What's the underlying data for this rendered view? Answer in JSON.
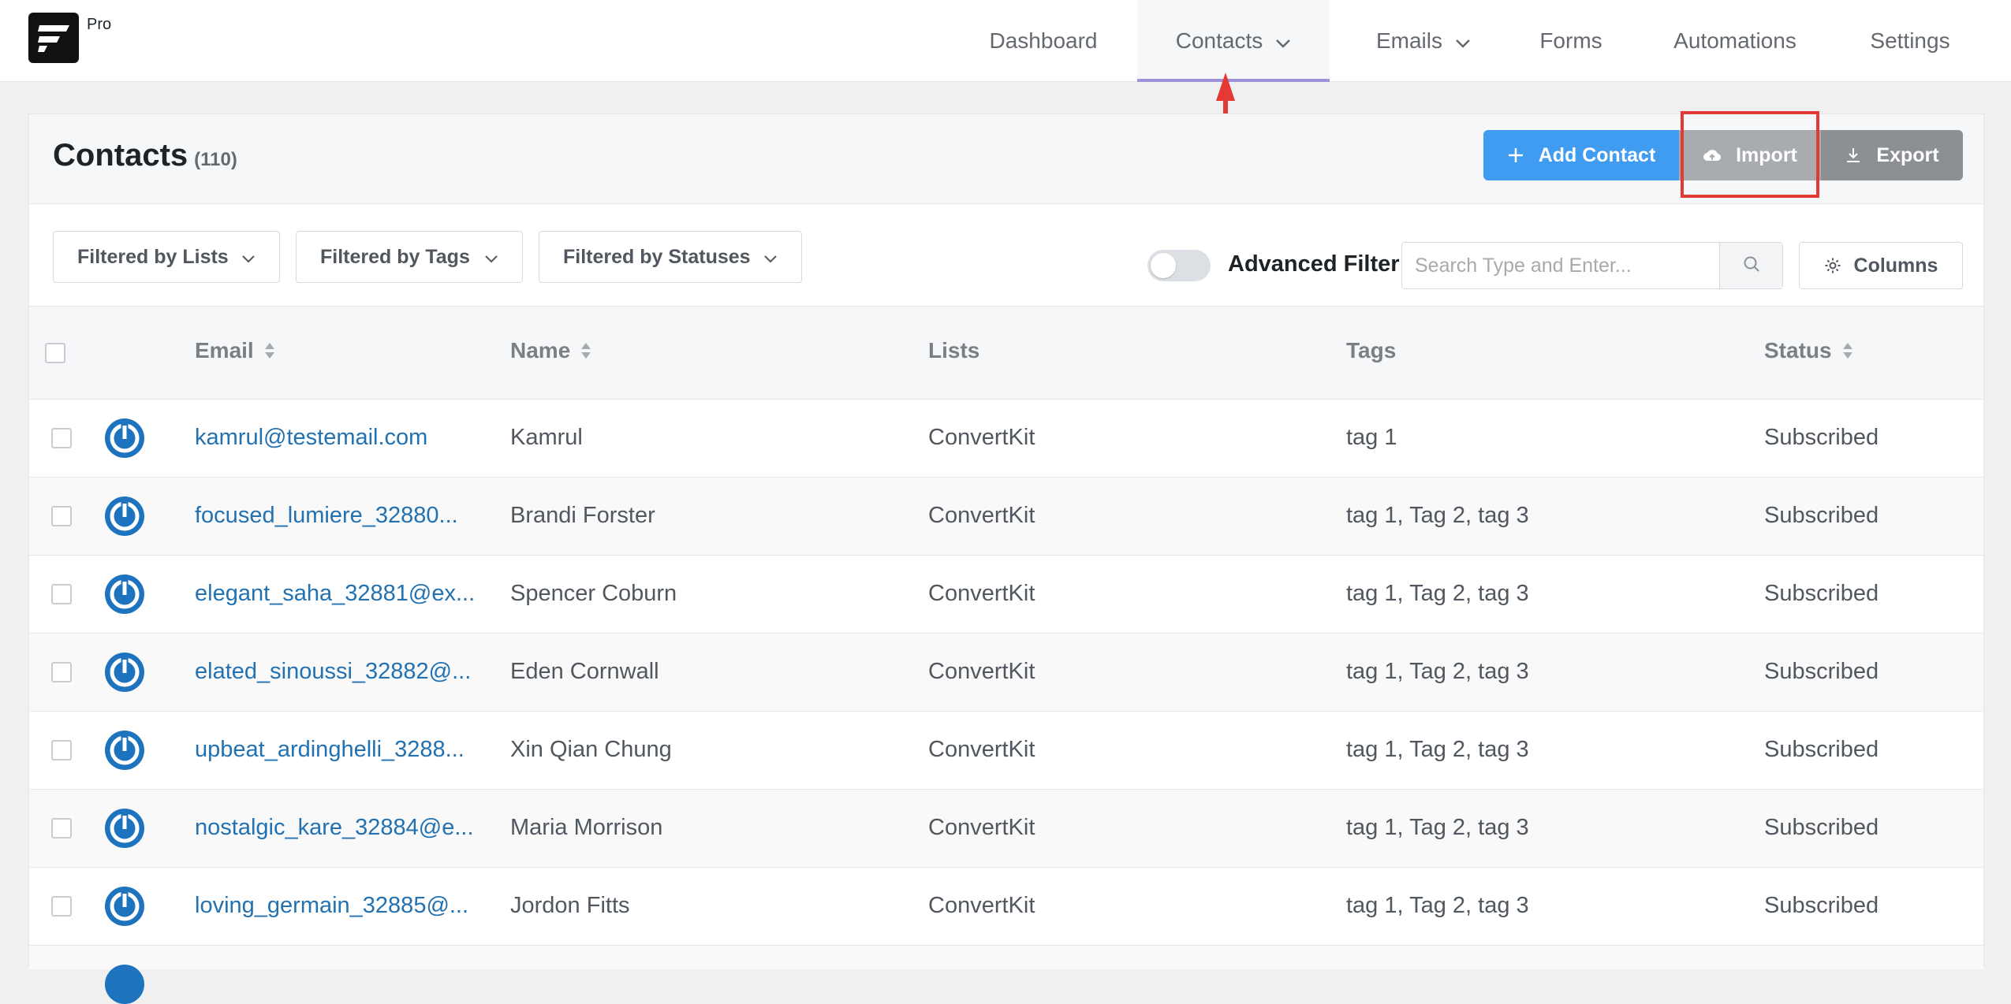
{
  "brand": {
    "label": "Pro"
  },
  "nav": {
    "dashboard": "Dashboard",
    "contacts": "Contacts",
    "emails": "Emails",
    "forms": "Forms",
    "automations": "Automations",
    "settings": "Settings"
  },
  "header": {
    "title": "Contacts",
    "count": "(110)",
    "add_contact": "Add Contact",
    "import": "Import",
    "export": "Export"
  },
  "filters": {
    "lists": "Filtered by Lists",
    "tags": "Filtered by Tags",
    "statuses": "Filtered by Statuses",
    "advanced": "Advanced Filter",
    "search_placeholder": "Search Type and Enter...",
    "columns": "Columns"
  },
  "table": {
    "columns": {
      "email": "Email",
      "name": "Name",
      "lists": "Lists",
      "tags": "Tags",
      "status": "Status"
    },
    "rows": [
      {
        "email": "kamrul@testemail.com",
        "name": "Kamrul",
        "lists": "ConvertKit",
        "tags": "tag 1",
        "status": "Subscribed"
      },
      {
        "email": "focused_lumiere_32880...",
        "name": "Brandi Forster",
        "lists": "ConvertKit",
        "tags": "tag 1, Tag 2, tag 3",
        "status": "Subscribed"
      },
      {
        "email": "elegant_saha_32881@ex...",
        "name": "Spencer Coburn",
        "lists": "ConvertKit",
        "tags": "tag 1, Tag 2, tag 3",
        "status": "Subscribed"
      },
      {
        "email": "elated_sinoussi_32882@...",
        "name": "Eden Cornwall",
        "lists": "ConvertKit",
        "tags": "tag 1, Tag 2, tag 3",
        "status": "Subscribed"
      },
      {
        "email": "upbeat_ardinghelli_3288...",
        "name": "Xin Qian Chung",
        "lists": "ConvertKit",
        "tags": "tag 1, Tag 2, tag 3",
        "status": "Subscribed"
      },
      {
        "email": "nostalgic_kare_32884@e...",
        "name": "Maria Morrison",
        "lists": "ConvertKit",
        "tags": "tag 1, Tag 2, tag 3",
        "status": "Subscribed"
      },
      {
        "email": "loving_germain_32885@...",
        "name": "Jordon Fitts",
        "lists": "ConvertKit",
        "tags": "tag 1, Tag 2, tag 3",
        "status": "Subscribed"
      }
    ]
  },
  "colors": {
    "accent_blue": "#3f9cf1",
    "link_blue": "#2271b1",
    "nav_underline": "#9d92d8",
    "annotation_red": "#e53935"
  },
  "icons": [
    "fluentcrm-logo",
    "chevron-down-icon",
    "plus-icon",
    "cloud-upload-icon",
    "download-icon",
    "search-icon",
    "gear-icon",
    "sort-icon",
    "avatar-icon",
    "annotation-arrow"
  ]
}
